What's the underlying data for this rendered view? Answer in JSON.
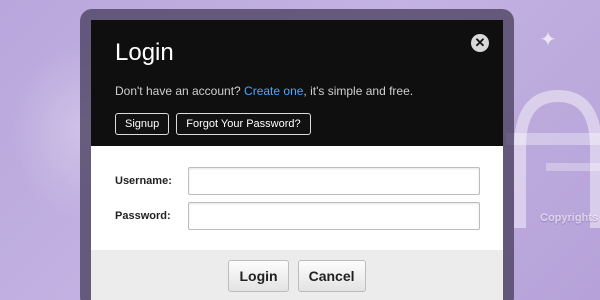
{
  "modal": {
    "title": "Login",
    "close_symbol": "✕",
    "subtitle": {
      "prefix": "Don't have an account? ",
      "link": "Create one",
      "suffix": ", it's simple and free."
    },
    "signup_label": "Signup",
    "forgot_label": "Forgot Your Password?"
  },
  "form": {
    "username_label": "Username:",
    "username_value": "",
    "password_label": "Password:",
    "password_value": ""
  },
  "footer": {
    "login_label": "Login",
    "cancel_label": "Cancel"
  },
  "background": {
    "copyright_text": "Copyrights"
  },
  "colors": {
    "header_bg": "#0f0f0f",
    "link": "#4aa6ff",
    "footer_bg": "#ececec",
    "page_bg": "#bda9df"
  }
}
